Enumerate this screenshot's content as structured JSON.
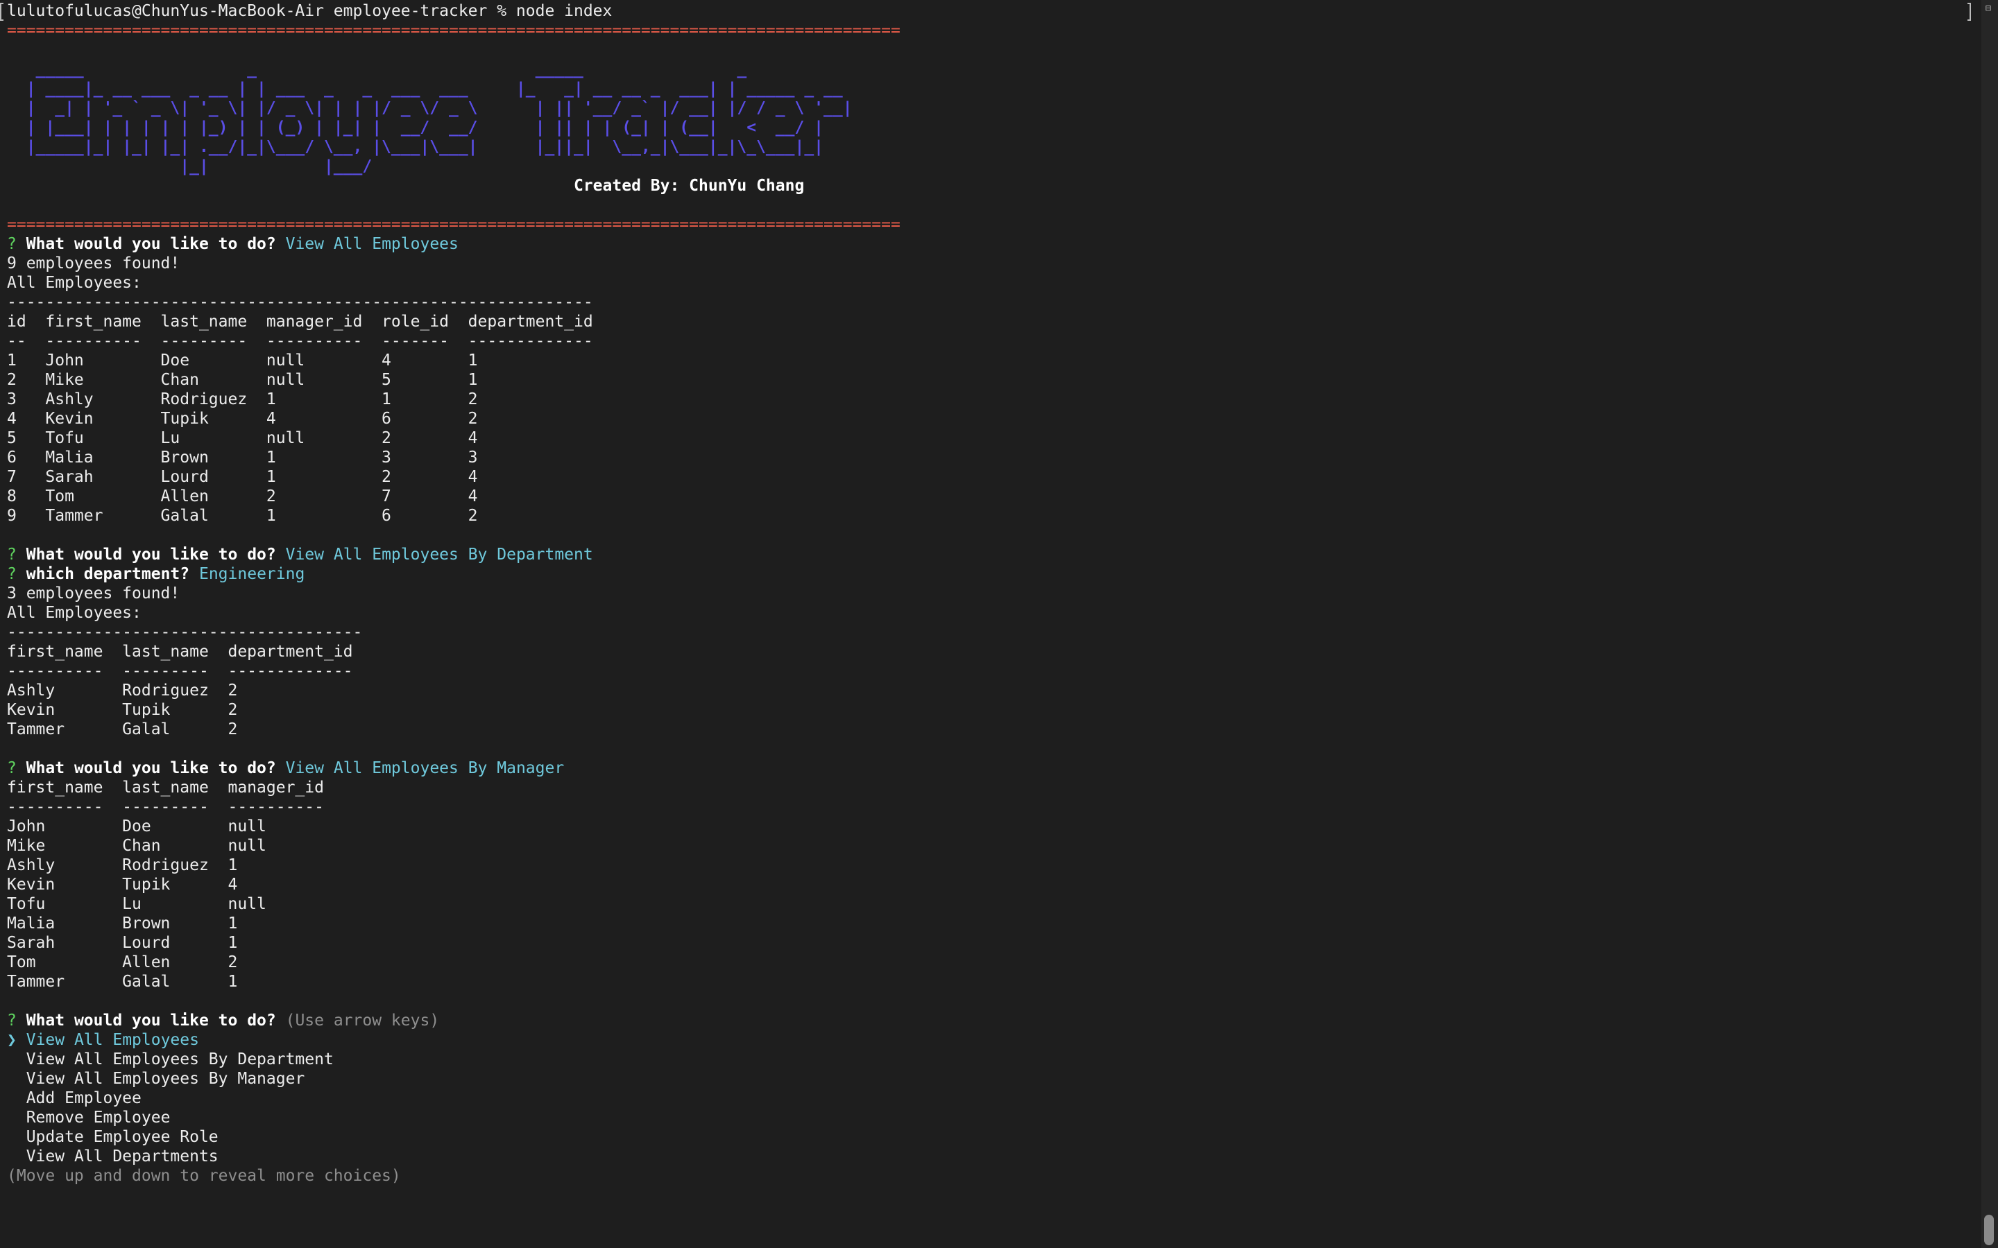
{
  "shell": {
    "prompt": "lulutofulucas@ChunYus-MacBook-Air employee-tracker % ",
    "command": "node index"
  },
  "banner": {
    "rule": "=============================================================================================",
    "ascii": [
      "   _____                 _                             _____                _",
      "  | ____|_ __ ___  _ __ | | ___  _   _  ___  ___     |_   _| __ __ _  ___| | _____ _ __",
      "  |  _| | '_ ` _ \\| '_ \\| |/ _ \\| | | |/ _ \\/ _ \\      | || '__/ _` |/ __| |/ / _ \\ '__|",
      "  | |___| | | | | | |_) | | (_) | |_| |  __/  __/      | || | | (_| | (__|   <  __/ |",
      "  |_____|_| |_| |_| .__/|_|\\___/ \\__, |\\___|\\___|      |_||_|  \\__,_|\\___|_|\\_\\___|_|",
      "                  |_|            |___/"
    ],
    "credit": "Created By: ChunYu Chang"
  },
  "session1": {
    "question": "What would you like to do?",
    "answer": "View All Employees",
    "found": "9 employees found!",
    "heading": "All Employees:",
    "rule": "-------------------------------------------------------------",
    "header": "id  first_name  last_name  manager_id  role_id  department_id",
    "divider": "--  ----------  ---------  ----------  -------  -------------",
    "rows": [
      "1   John        Doe        null        4        1",
      "2   Mike        Chan       null        5        1",
      "3   Ashly       Rodriguez  1           1        2",
      "4   Kevin       Tupik      4           6        2",
      "5   Tofu        Lu         null        2        4",
      "6   Malia       Brown      1           3        3",
      "7   Sarah       Lourd      1           2        4",
      "8   Tom         Allen      2           7        4",
      "9   Tammer      Galal      1           6        2"
    ]
  },
  "session2": {
    "question": "What would you like to do?",
    "answer": "View All Employees By Department",
    "sub_question": "which department?",
    "sub_answer": "Engineering",
    "found": "3 employees found!",
    "heading": "All Employees:",
    "rule": "-------------------------------------",
    "header": "first_name  last_name  department_id",
    "divider": "----------  ---------  -------------",
    "rows": [
      "Ashly       Rodriguez  2",
      "Kevin       Tupik      2",
      "Tammer      Galal      2"
    ]
  },
  "session3": {
    "question": "What would you like to do?",
    "answer": "View All Employees By Manager",
    "header": "first_name  last_name  manager_id",
    "divider": "----------  ---------  ----------",
    "rows": [
      "John        Doe        null",
      "Mike        Chan       null",
      "Ashly       Rodriguez  1",
      "Kevin       Tupik      4",
      "Tofu        Lu         null",
      "Malia       Brown      1",
      "Sarah       Lourd      1",
      "Tom         Allen      2",
      "Tammer      Galal      1"
    ]
  },
  "menu": {
    "question_mark": "?",
    "question": "What would you like to do?",
    "hint": "(Use arrow keys)",
    "pointer": "❯",
    "selected": "View All Employees",
    "options": [
      "View All Employees By Department",
      "View All Employees By Manager",
      "Add Employee",
      "Remove Employee",
      "Update Employee Role",
      "View All Departments"
    ],
    "footer": "(Move up and down to reveal more choices)"
  },
  "colors": {
    "background": "#1e1e1e",
    "rule_red": "#e25a48",
    "ascii_purple": "#5a4ee6",
    "prompt_green": "#5fd35f",
    "answer_cyan": "#6fc9dc",
    "hint_grey": "#8e8e8e"
  },
  "icons": {
    "scroll_top": "split-view-icon"
  }
}
